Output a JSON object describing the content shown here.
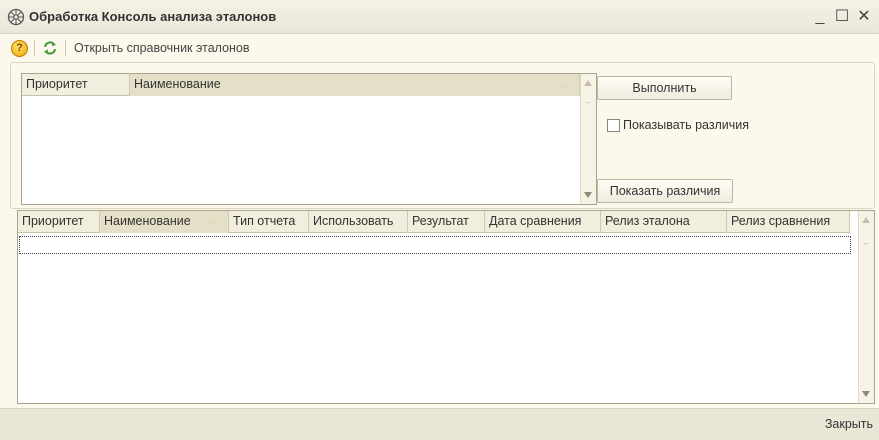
{
  "window": {
    "title": "Обработка  Консоль анализа эталонов",
    "minimize": "_",
    "maximize": "☐",
    "close": "✕"
  },
  "toolbar": {
    "help_icon": "help-icon",
    "refresh_icon": "refresh-icon",
    "open_directory_label": "Открыть справочник эталонов"
  },
  "top_grid": {
    "columns": [
      "Приоритет",
      "Наименование"
    ],
    "sorted_column": "Наименование"
  },
  "actions": {
    "run_label": "Выполнить",
    "show_diff_checkbox_label": "Показывать различия",
    "show_diff_checked": false,
    "show_diff_button_label": "Показать различия"
  },
  "bottom_grid": {
    "columns": [
      "Приоритет",
      "Наименование",
      "Тип отчета",
      "Использовать",
      "Результат",
      "Дата сравнения",
      "Релиз эталона",
      "Релиз сравнения"
    ],
    "sorted_column": "Наименование"
  },
  "footer": {
    "close_label": "Закрыть"
  },
  "colors": {
    "background": "#fcf9ec",
    "header_bg": "#f1eedd",
    "sorted_header_bg": "#e4dfc6",
    "refresh_green": "#3a9a3a"
  }
}
